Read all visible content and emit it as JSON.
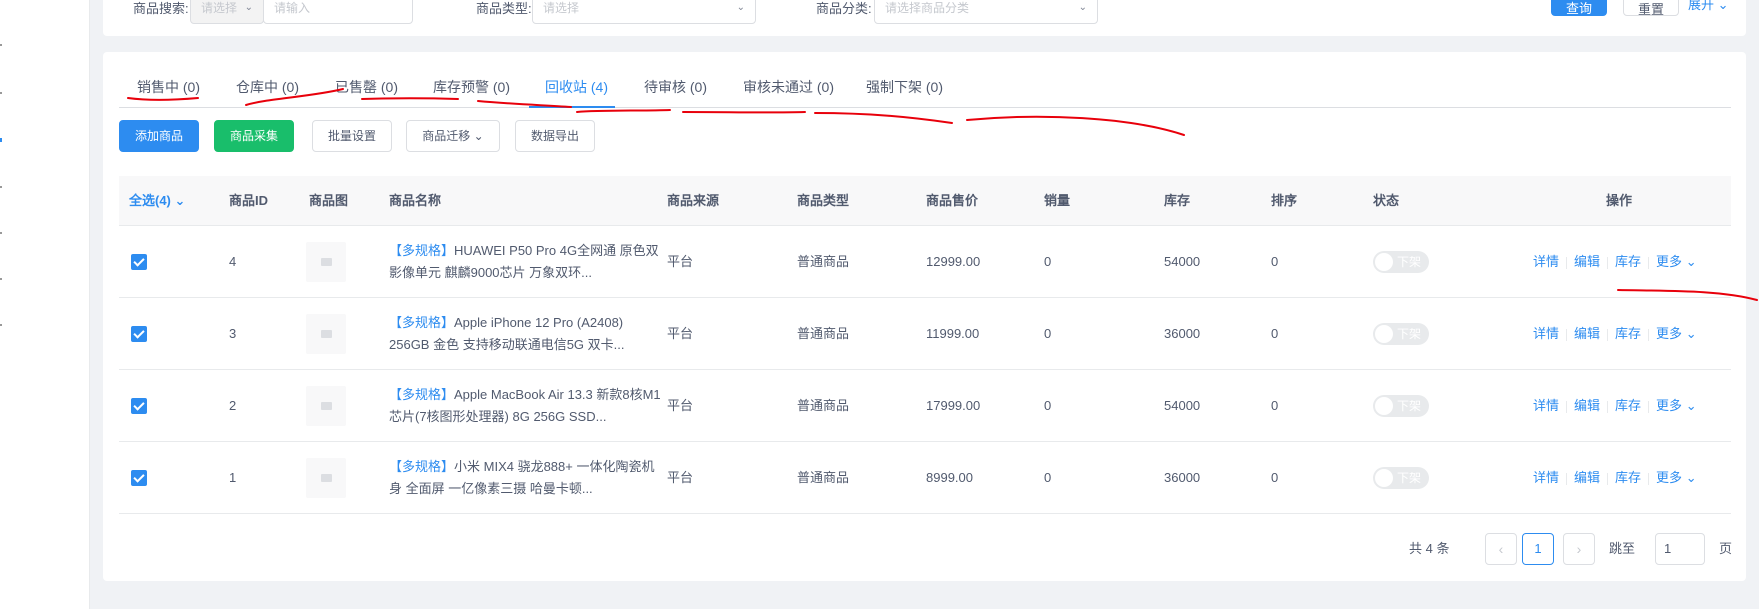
{
  "filters": {
    "search_label": "商品搜索:",
    "search_select_placeholder": "请选择",
    "search_input_placeholder": "请输入",
    "type_label": "商品类型:",
    "type_placeholder": "请选择",
    "category_label": "商品分类:",
    "category_placeholder": "请选择商品分类",
    "query_label": "查询",
    "reset_label": "重置",
    "expand_label": "展开"
  },
  "tabs": [
    {
      "label": "销售中 (0)"
    },
    {
      "label": "仓库中 (0)"
    },
    {
      "label": "已售罄 (0)"
    },
    {
      "label": "库存预警 (0)"
    },
    {
      "label": "回收站 (4)",
      "active": true
    },
    {
      "label": "待审核 (0)"
    },
    {
      "label": "审核未通过 (0)"
    },
    {
      "label": "强制下架 (0)"
    }
  ],
  "toolbar": {
    "add_label": "添加商品",
    "collect_label": "商品采集",
    "batch_label": "批量设置",
    "migrate_label": "商品迁移",
    "export_label": "数据导出"
  },
  "table": {
    "headers": {
      "select_all": "全选(4)",
      "id": "商品ID",
      "image": "商品图",
      "name": "商品名称",
      "source": "商品来源",
      "type": "商品类型",
      "price": "商品售价",
      "sales": "销量",
      "stock": "库存",
      "sort": "排序",
      "status": "状态",
      "actions": "操作"
    },
    "rows": [
      {
        "id": "4",
        "tag": "【多规格】",
        "name": "HUAWEI P50 Pro 4G全网通 原色双影像单元 麒麟9000芯片 万象双环...",
        "source": "平台",
        "type": "普通商品",
        "price": "12999.00",
        "sales": "0",
        "stock": "54000",
        "sort": "0",
        "status": "下架"
      },
      {
        "id": "3",
        "tag": "【多规格】",
        "name": "Apple iPhone 12 Pro (A2408) 256GB 金色 支持移动联通电信5G 双卡...",
        "source": "平台",
        "type": "普通商品",
        "price": "11999.00",
        "sales": "0",
        "stock": "36000",
        "sort": "0",
        "status": "下架"
      },
      {
        "id": "2",
        "tag": "【多规格】",
        "name": "Apple MacBook Air 13.3 新款8核M1芯片(7核图形处理器) 8G 256G SSD...",
        "source": "平台",
        "type": "普通商品",
        "price": "17999.00",
        "sales": "0",
        "stock": "54000",
        "sort": "0",
        "status": "下架"
      },
      {
        "id": "1",
        "tag": "【多规格】",
        "name": "小米 MIX4 骁龙888+ 一体化陶瓷机身 全面屏 一亿像素三摄 哈曼卡顿...",
        "source": "平台",
        "type": "普通商品",
        "price": "8999.00",
        "sales": "0",
        "stock": "36000",
        "sort": "0",
        "status": "下架"
      }
    ],
    "row_actions": {
      "detail": "详情",
      "edit": "编辑",
      "stock": "库存",
      "more": "更多"
    }
  },
  "pagination": {
    "total": "共 4 条",
    "current_page": "1",
    "jump_label": "跳至",
    "jump_value": "1",
    "page_unit": "页"
  },
  "colors": {
    "primary": "#2d8cf0",
    "success": "#19be6b",
    "annotation": "#e8000b"
  }
}
